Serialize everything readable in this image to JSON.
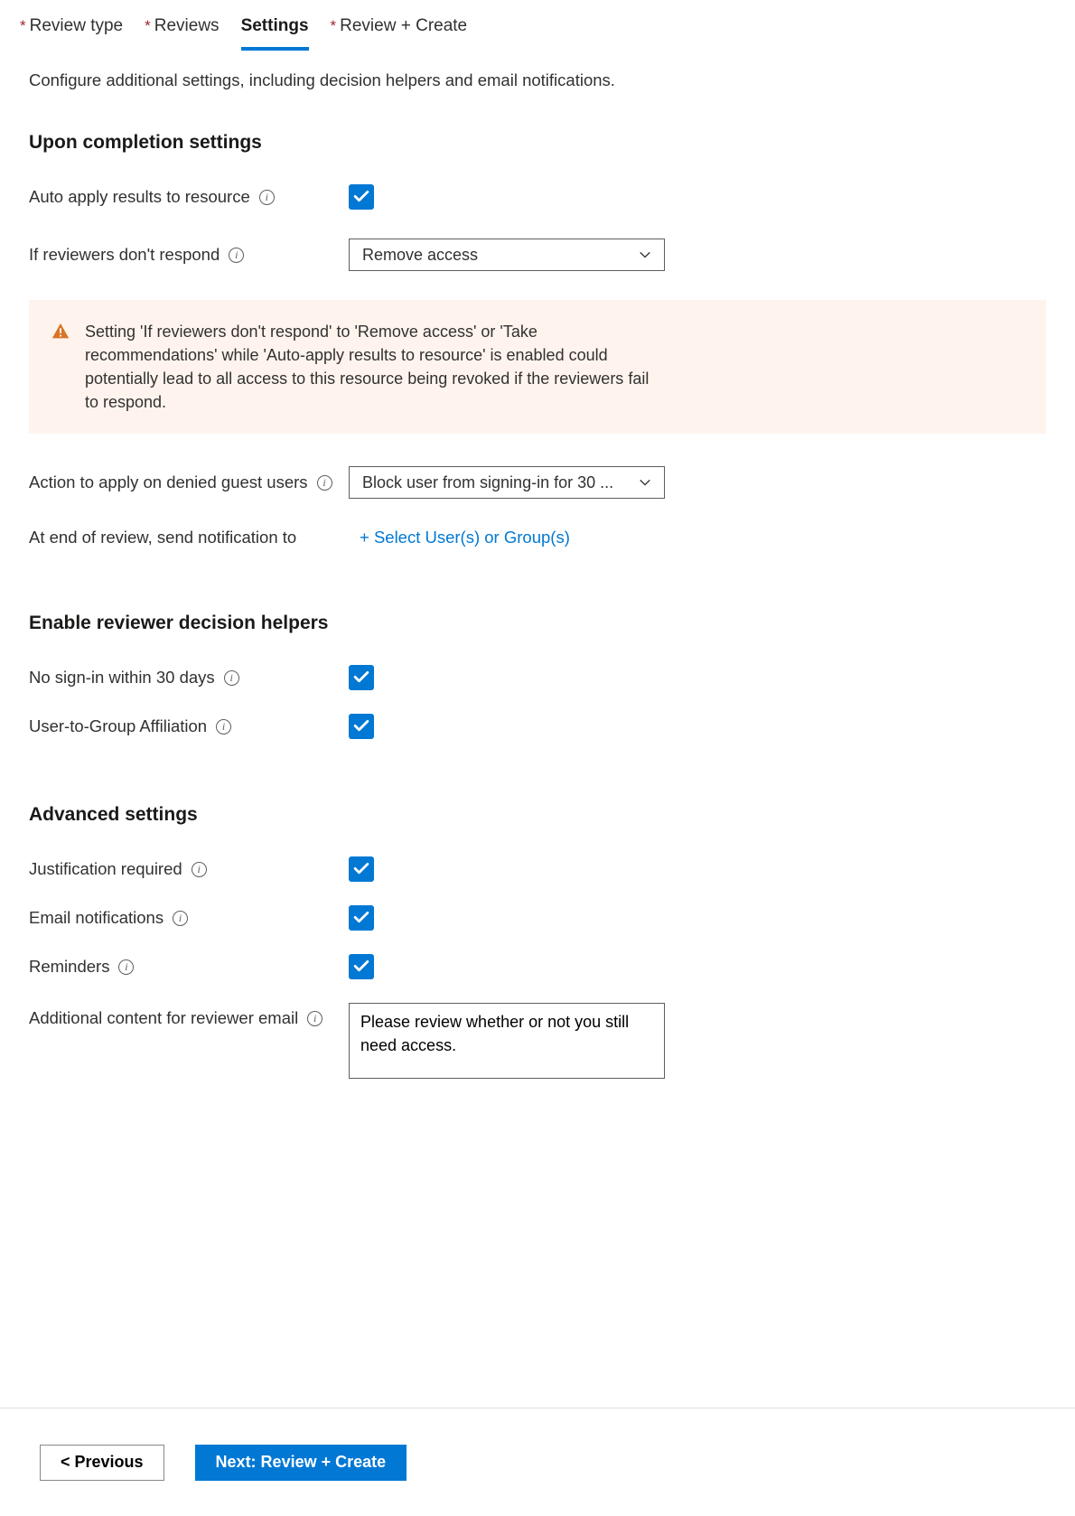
{
  "tabs": {
    "review_type": "Review type",
    "reviews": "Reviews",
    "settings": "Settings",
    "review_create": "Review + Create"
  },
  "intro": "Configure additional settings, including decision helpers and email notifications.",
  "upon_completion": {
    "title": "Upon completion settings",
    "auto_apply_label": "Auto apply results to resource",
    "no_response_label": "If reviewers don't respond",
    "no_response_value": "Remove access",
    "warning": "Setting 'If reviewers don't respond' to 'Remove access' or 'Take recommendations' while 'Auto-apply results to resource' is enabled could potentially lead to all access to this resource being revoked if the reviewers fail to respond.",
    "denied_guest_label": "Action to apply on denied guest users",
    "denied_guest_value": "Block user from signing-in for 30 ...",
    "notification_label": "At end of review, send notification to",
    "notification_link": "+ Select User(s) or Group(s)"
  },
  "decision_helpers": {
    "title": "Enable reviewer decision helpers",
    "no_signin_label": "No sign-in within 30 days",
    "group_aff_label": "User-to-Group Affiliation"
  },
  "advanced": {
    "title": "Advanced settings",
    "justification_label": "Justification required",
    "email_label": "Email notifications",
    "reminders_label": "Reminders",
    "additional_content_label": "Additional content for reviewer email",
    "additional_content_value": "Please review whether or not you still need access."
  },
  "footer": {
    "previous": "< Previous",
    "next": "Next: Review + Create"
  }
}
